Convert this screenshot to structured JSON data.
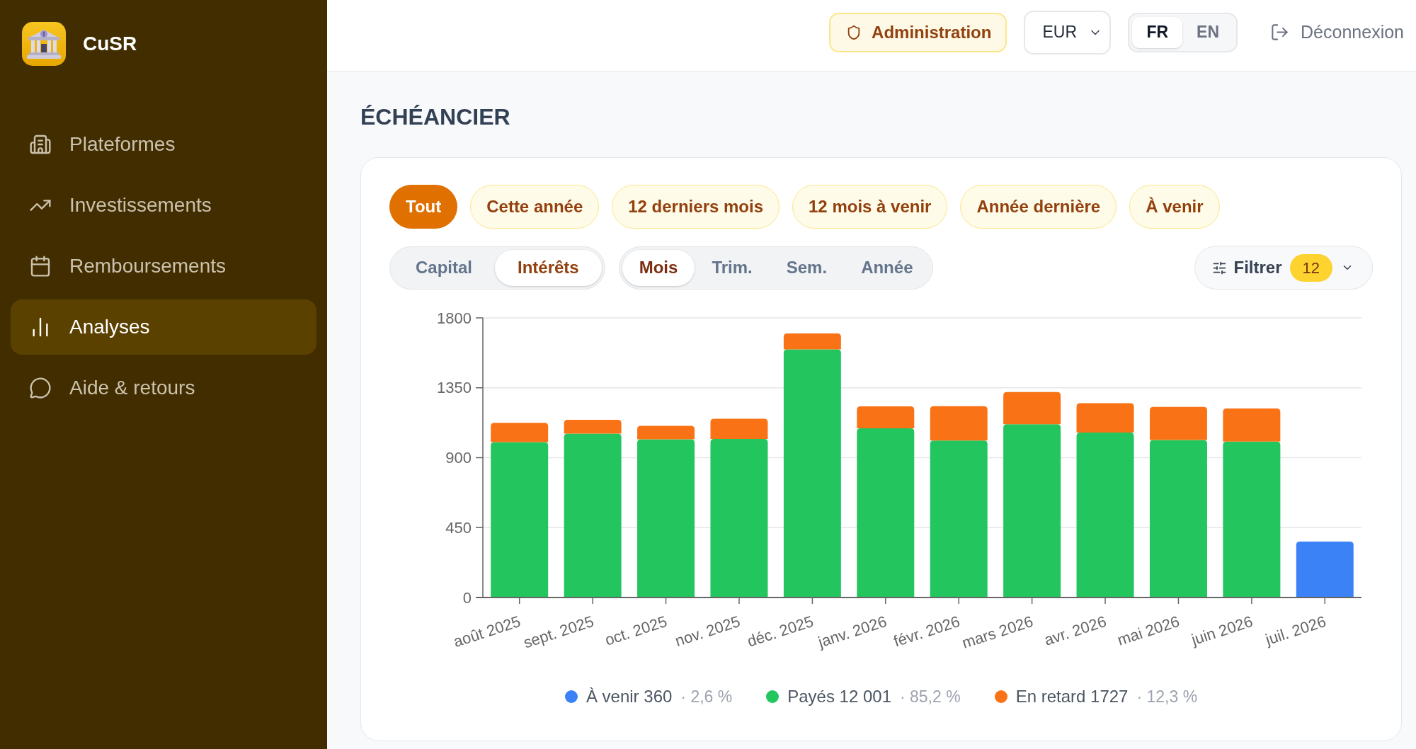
{
  "sidebar": {
    "brand": {
      "name": "CuSR"
    },
    "items": [
      {
        "label": "Plateformes",
        "selected": false
      },
      {
        "label": "Investissements",
        "selected": false
      },
      {
        "label": "Remboursements",
        "selected": false
      },
      {
        "label": "Analyses",
        "selected": true
      },
      {
        "label": "Aide & retours",
        "selected": false
      }
    ]
  },
  "header": {
    "admin_button": {
      "label": "Administration"
    },
    "currency_select": {
      "value": "EUR"
    },
    "language_toggle": [
      {
        "label": "FR",
        "selected": true
      },
      {
        "label": "EN",
        "selected": false
      }
    ],
    "logout": {
      "label": "Déconnexion"
    }
  },
  "page": {
    "title": "ÉCHÉANCIER",
    "period_filters": [
      {
        "label": "Tout",
        "selected": true
      },
      {
        "label": "Cette année",
        "selected": false
      },
      {
        "label": "12 derniers mois",
        "selected": false
      },
      {
        "label": "12 mois à venir",
        "selected": false
      },
      {
        "label": "Année dernière",
        "selected": false
      },
      {
        "label": "À venir",
        "selected": false
      }
    ],
    "amount_toggle": [
      {
        "label": "Capital",
        "selected": false
      },
      {
        "label": "Intérêts",
        "selected": true
      }
    ],
    "granularity_toggle": [
      {
        "label": "Mois",
        "selected": true
      },
      {
        "label": "Trim.",
        "selected": false
      },
      {
        "label": "Sem.",
        "selected": false
      },
      {
        "label": "Année",
        "selected": false
      }
    ],
    "filter_button": {
      "label": "Filtrer",
      "count": "12"
    },
    "chart_data": {
      "type": "bar",
      "stacked": true,
      "grid": true,
      "categories": [
        "août 2025",
        "sept. 2025",
        "oct. 2025",
        "nov. 2025",
        "déc. 2025",
        "janv. 2026",
        "févr. 2026",
        "mars 2026",
        "avr. 2026",
        "mai 2026",
        "juin 2026",
        "juil. 2026"
      ],
      "series": [
        {
          "name": "À venir",
          "color": "#3b82f6",
          "values": [
            0,
            0,
            0,
            0,
            0,
            0,
            0,
            0,
            0,
            0,
            0,
            360
          ]
        },
        {
          "name": "Payés",
          "color": "#22c55e",
          "values": [
            1000,
            1055,
            1018,
            1021,
            1597,
            1089,
            1010,
            1115,
            1062,
            1014,
            1004,
            0
          ]
        },
        {
          "name": "En retard",
          "color": "#f97316",
          "values": [
            125,
            89,
            87,
            130,
            103,
            141,
            221,
            208,
            189,
            213,
            213,
            0
          ]
        }
      ],
      "ylim": [
        0,
        1800
      ],
      "yticks": [
        0,
        450,
        900,
        1350,
        1800
      ]
    },
    "legend": [
      {
        "total": "360",
        "share": "· 2,6 %"
      },
      {
        "total": "12 001",
        "share": "· 85,2 %"
      },
      {
        "total": "1727",
        "share": "· 12,3 %"
      }
    ]
  }
}
